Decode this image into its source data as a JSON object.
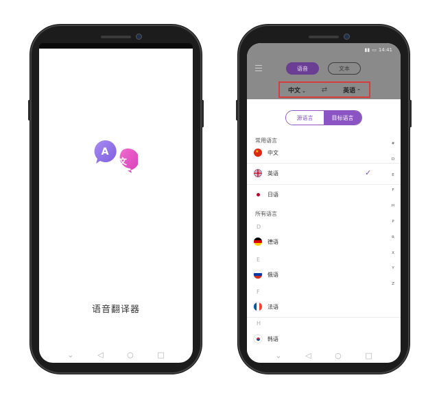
{
  "splash": {
    "app_name": "语音翻译器",
    "logo_left_glyph": "A",
    "logo_right_glyph": "文"
  },
  "nav_icons": [
    "chevron-down-icon",
    "back-icon",
    "home-icon",
    "recents-icon"
  ],
  "translator": {
    "status_time": "14:41",
    "mode_tabs": [
      "语音",
      "文本"
    ],
    "active_mode": "语音",
    "source_lang": "中文",
    "target_lang": "英语",
    "picker": {
      "tabs": [
        "源语言",
        "目标语言"
      ],
      "active_tab": "目标语言",
      "common_title": "常用语言",
      "common": [
        {
          "name": "中文",
          "selected": false
        },
        {
          "name": "英语",
          "selected": true
        },
        {
          "name": "日语",
          "selected": false
        }
      ],
      "all_title": "所有语言",
      "groups": [
        {
          "letter": "D",
          "items": [
            "德语"
          ]
        },
        {
          "letter": "E",
          "items": [
            "俄语"
          ]
        },
        {
          "letter": "F",
          "items": [
            "法语"
          ]
        },
        {
          "letter": "H",
          "items": [
            "韩语"
          ]
        }
      ],
      "index": [
        "#",
        "D",
        "E",
        "F",
        "H",
        "P",
        "R",
        "X",
        "Y",
        "Z"
      ]
    }
  },
  "colors": {
    "accent": "#8a55c2",
    "header_gray": "#8a8a8a",
    "highlight_box": "#d93a3a"
  }
}
